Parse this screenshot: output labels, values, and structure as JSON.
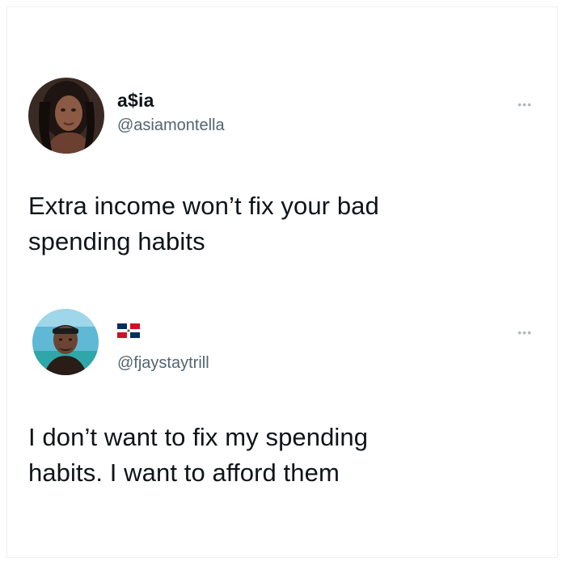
{
  "tweets": [
    {
      "display_name": "a$ia",
      "handle": "@asiamontella",
      "text_lines": [
        "Extra income won’t fix your bad",
        "spending habits"
      ],
      "more": "•••"
    },
    {
      "display_name_icon": "dominican-republic-flag-icon",
      "handle": "@fjaystaytrill",
      "text_lines": [
        "I don’t want to fix my spending",
        "habits. I want to afford them"
      ],
      "more": "•••"
    }
  ]
}
